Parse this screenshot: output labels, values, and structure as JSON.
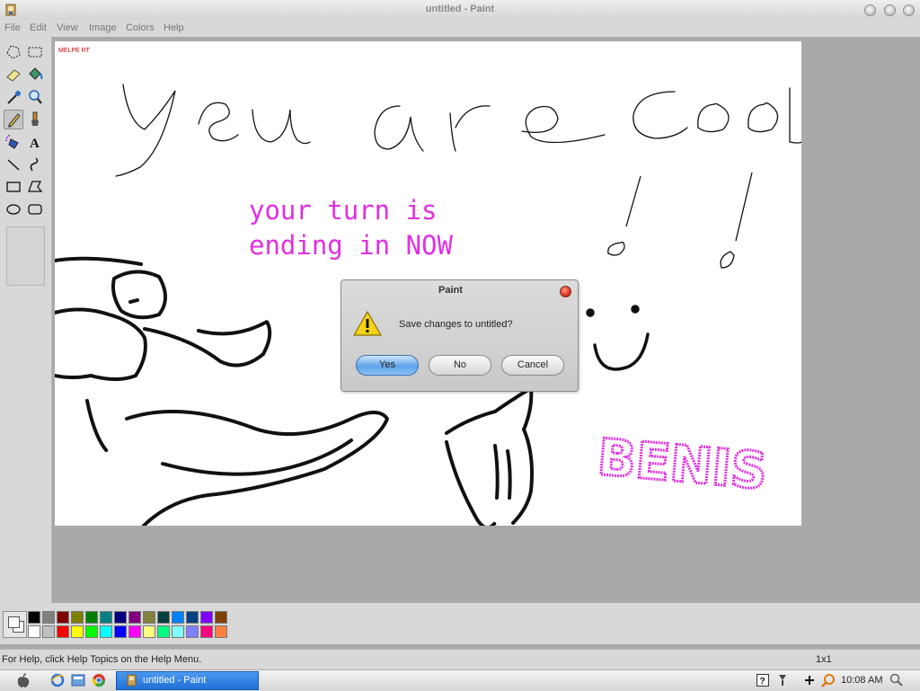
{
  "window": {
    "title": "untitled - Paint"
  },
  "menu": {
    "items": [
      {
        "label": "File"
      },
      {
        "label": "Edit"
      },
      {
        "label": "View"
      },
      {
        "label": "Image"
      },
      {
        "label": "Colors"
      },
      {
        "label": "Help"
      }
    ]
  },
  "toolbox": {
    "tools": [
      "free-form-select",
      "rect-select",
      "eraser",
      "fill",
      "color-picker",
      "magnifier",
      "pencil",
      "brush",
      "airbrush",
      "text",
      "line",
      "curve",
      "rectangle",
      "polygon",
      "ellipse",
      "rounded-rectangle"
    ],
    "selected": "pencil"
  },
  "canvas": {
    "signature": "MELPE RT",
    "handwriting": "you are cool",
    "typed_line1": "your turn is",
    "typed_line2": "ending in NOW",
    "magenta_text": "BENIS",
    "text_color": "#e030e0"
  },
  "dialog": {
    "title": "Paint",
    "message": "Save changes to untitled?",
    "icon": "warning-icon",
    "buttons": {
      "yes": "Yes",
      "no": "No",
      "cancel": "Cancel"
    }
  },
  "palette": {
    "colors": [
      "#000000",
      "#808080",
      "#800000",
      "#808000",
      "#008000",
      "#008080",
      "#000080",
      "#800080",
      "#808040",
      "#004040",
      "#0080ff",
      "#004080",
      "#8000ff",
      "#804000",
      "#ffffff",
      "#c0c0c0",
      "#ff0000",
      "#ffff00",
      "#00ff00",
      "#00ffff",
      "#0000ff",
      "#ff00ff",
      "#ffff80",
      "#00ff80",
      "#80ffff",
      "#8080ff",
      "#ff0080",
      "#ff8040"
    ],
    "foreground": "#ffffff",
    "background": "#ffffff"
  },
  "status": {
    "help_text": "For Help, click Help Topics on the Help Menu.",
    "size": "1x1"
  },
  "taskbar": {
    "task_label": "untitled - Paint",
    "clock": "10:08 AM",
    "quick_launch_icons": [
      "apple-icon",
      "ie-icon",
      "explorer-icon",
      "chrome-icon"
    ],
    "tray_icons": [
      "help-icon",
      "network-icon",
      "plus-icon",
      "volume-icon",
      "search-icon"
    ]
  }
}
